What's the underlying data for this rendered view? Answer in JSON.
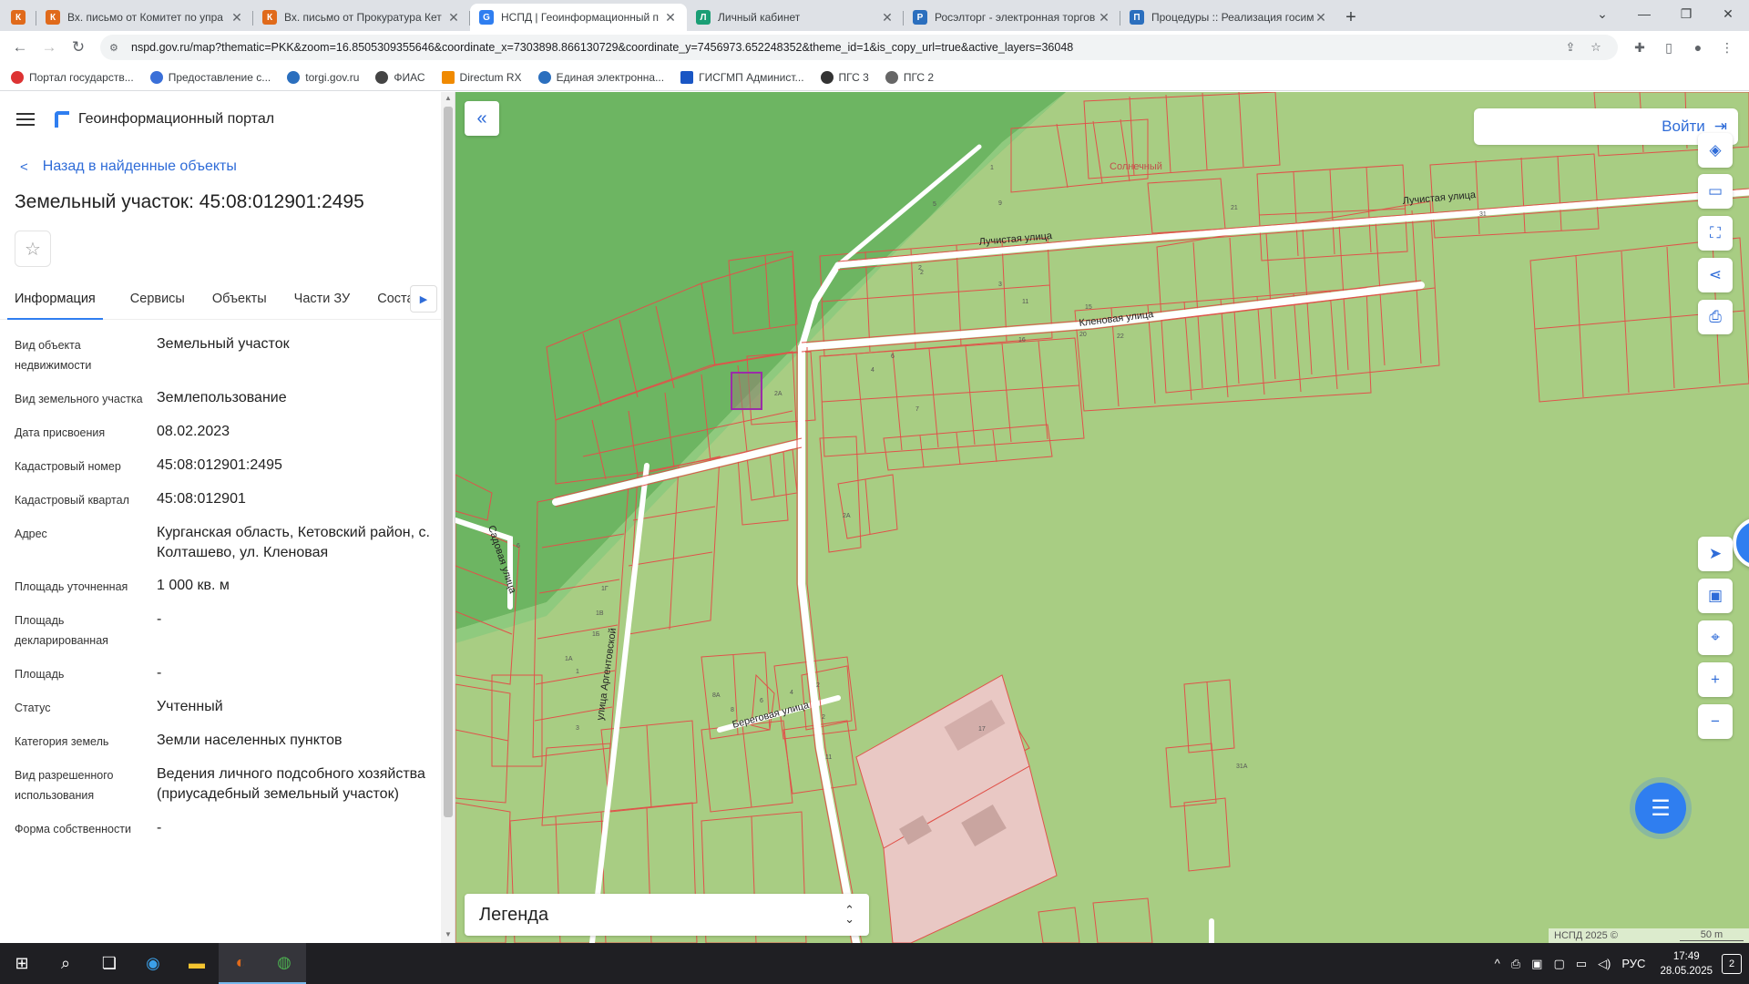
{
  "browser": {
    "tabs": [
      {
        "title": "Вх. письмо от Комитет по упра",
        "color": "#e06a1b"
      },
      {
        "title": "Вх. письмо от Прокуратура Кет",
        "color": "#e06a1b"
      },
      {
        "title": "НСПД | Геоинформационный п",
        "color": "#2f7ef0"
      },
      {
        "title": "Личный кабинет",
        "color": "#1a9e75"
      },
      {
        "title": "Росэлторг - электронная торгов",
        "color": "#2b6fbe"
      },
      {
        "title": "Процедуры :: Реализация госим",
        "color": "#2b6fbe"
      }
    ],
    "url": "nspd.gov.ru/map?thematic=PKK&zoom=16.8505309355646&coordinate_x=7303898.866130729&coordinate_y=7456973.652248352&theme_id=1&is_copy_url=true&active_layers=36048",
    "bookmarks": [
      {
        "label": "Портал государств...",
        "color": "#d33"
      },
      {
        "label": "Предоставление с...",
        "color": "#3a6fd8"
      },
      {
        "label": "torgi.gov.ru",
        "color": "#2b6fbe"
      },
      {
        "label": "ФИАС",
        "color": "#444"
      },
      {
        "label": "Directum RX",
        "color": "#f08a00"
      },
      {
        "label": "Единая электронна...",
        "color": "#2b6fbe"
      },
      {
        "label": "ГИСГМП Админист...",
        "color": "#1a56c4"
      },
      {
        "label": "ПГС 3",
        "color": "#333"
      },
      {
        "label": "ПГС 2",
        "color": "#666"
      }
    ]
  },
  "panel": {
    "portal_title": "Геоинформационный портал",
    "back_label": "Назад в найденные объекты",
    "object_title": "Земельный участок: 45:08:012901:2495",
    "tabs": [
      "Информация",
      "Сервисы",
      "Объекты",
      "Части ЗУ",
      "Соста"
    ],
    "rows": [
      {
        "key": "Вид объекта недвижимости",
        "value": "Земельный участок"
      },
      {
        "key": "Вид земельного участка",
        "value": "Землепользование"
      },
      {
        "key": "Дата присвоения",
        "value": "08.02.2023"
      },
      {
        "key": "Кадастровый номер",
        "value": "45:08:012901:2495"
      },
      {
        "key": "Кадастровый квартал",
        "value": "45:08:012901"
      },
      {
        "key": "Адрес",
        "value": "Курганская область, Кетовский район, с. Колташево, ул. Кленовая"
      },
      {
        "key": "Площадь уточненная",
        "value": "1 000 кв. м"
      },
      {
        "key": "Площадь декларированная",
        "value": "-"
      },
      {
        "key": "Площадь",
        "value": "-"
      },
      {
        "key": "Статус",
        "value": "Учтенный"
      },
      {
        "key": "Категория земель",
        "value": "Земли населенных пунктов"
      },
      {
        "key": "Вид разрешенного использования",
        "value": "Ведения личного подсобного хозяйства (приусадебный земельный участок)"
      },
      {
        "key": "Форма собственности",
        "value": "-"
      }
    ]
  },
  "map": {
    "login_label": "Войти",
    "legend_label": "Легенда",
    "attribution": "НСПД 2025 ©",
    "scale_label": "50 m",
    "streets": [
      "Лучистая улица",
      "Лучистая улица",
      "Кленовая улица",
      "Садовая улица",
      "улица Аргентовской",
      "Береговая улица"
    ],
    "place_label": "Солнечный",
    "parcel_numbers": [
      "1",
      "2",
      "5",
      "9",
      "2",
      "4",
      "6",
      "7",
      "16",
      "20",
      "22",
      "21",
      "15",
      "11",
      "3",
      "2А",
      "2А",
      "6",
      "1Г",
      "1В",
      "1Б",
      "1А",
      "1",
      "8А",
      "8",
      "6",
      "4",
      "2",
      "2",
      "11",
      "17",
      "31А",
      "31",
      "3"
    ]
  },
  "taskbar": {
    "lang": "РУС",
    "time": "17:49",
    "date": "28.05.2025",
    "notifications": "2"
  }
}
